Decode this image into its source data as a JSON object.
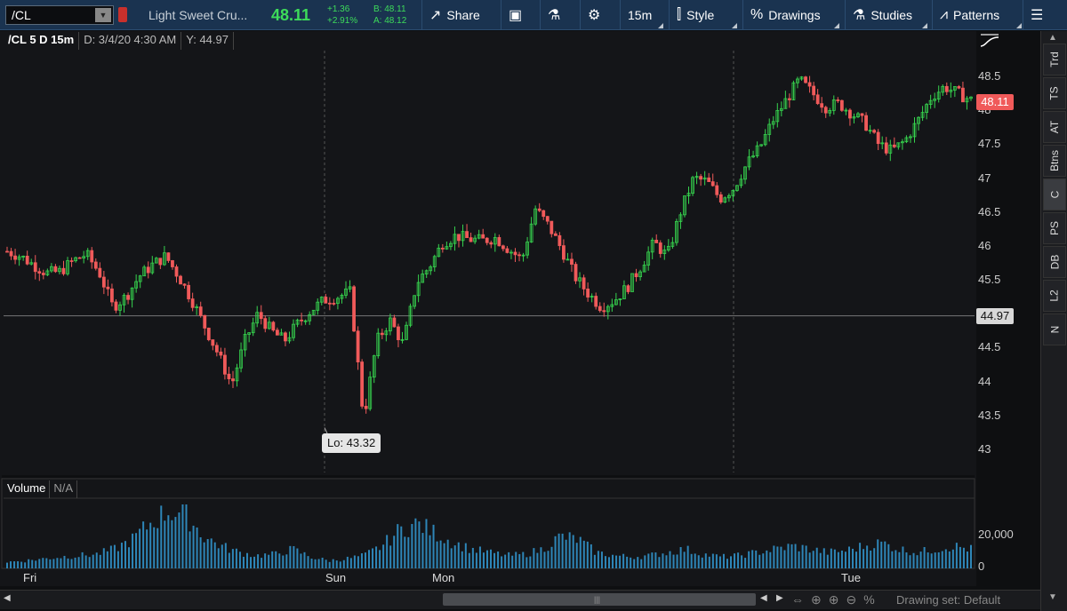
{
  "toolbar": {
    "symbol": "/CL",
    "description": "Light Sweet Cru...",
    "last_price": "48.11",
    "net_change": "+1.36",
    "pct_change": "+2.91%",
    "bid": "B: 48.11",
    "ask": "A: 48.12",
    "share_label": "Share",
    "timeframe_label": "15m",
    "style_label": "Style",
    "drawings_label": "Drawings",
    "studies_label": "Studies",
    "patterns_label": "Patterns",
    "accent_up": "#3ddc5a",
    "accent_down": "#f05a5a"
  },
  "chart_header": {
    "symbol_tf": "/CL 5 D 15m",
    "date": "D: 3/4/20 4:30 AM",
    "y": "Y: 44.97"
  },
  "price_axis": {
    "ticks": [
      "48.5",
      "48",
      "47.5",
      "47",
      "46.5",
      "46",
      "45.5",
      "45",
      "44.5",
      "44",
      "43.5",
      "43"
    ],
    "last_tag": "48.11",
    "crosshair_tag": "44.97"
  },
  "low_label": "Lo: 43.32",
  "volume": {
    "title": "Volume",
    "value": "N/A",
    "ticks": [
      "20,000",
      "0"
    ]
  },
  "time_axis": [
    "Fri",
    "Sun",
    "Mon",
    "Tue"
  ],
  "footer": {
    "drawing_set": "Drawing set: Default"
  },
  "side_tabs": [
    "Trd",
    "TS",
    "AT",
    "Btns",
    "C",
    "PS",
    "DB",
    "L2",
    "N"
  ],
  "chart_data": {
    "type": "candlestick",
    "price_range": [
      42.8,
      48.8
    ],
    "crosshair_price": 44.97,
    "low": 43.32,
    "close_path": [
      45.92,
      45.85,
      45.72,
      45.6,
      45.62,
      45.78,
      45.88,
      45.6,
      45.1,
      45.25,
      45.55,
      45.72,
      45.85,
      45.55,
      45.2,
      44.8,
      44.4,
      43.95,
      44.6,
      45.0,
      44.75,
      44.6,
      44.85,
      45.05,
      45.2,
      45.25,
      45.32,
      43.45,
      44.6,
      44.9,
      44.55,
      45.45,
      45.7,
      46.05,
      46.15,
      46.1,
      46.08,
      46.12,
      45.95,
      45.8,
      46.55,
      46.3,
      45.95,
      45.55,
      45.3,
      45.1,
      45.2,
      45.4,
      45.7,
      46.05,
      45.85,
      46.5,
      47.0,
      46.95,
      46.7,
      46.85,
      47.2,
      47.45,
      47.85,
      48.15,
      48.45,
      48.25,
      48.05,
      48.1,
      47.95,
      47.8,
      47.5,
      47.4,
      47.55,
      47.85,
      48.2,
      48.35,
      48.25,
      48.15
    ],
    "volume_relative": [
      0.1,
      0.12,
      0.15,
      0.18,
      0.2,
      0.22,
      0.3,
      0.45,
      0.7,
      0.9,
      0.85,
      0.5,
      0.35,
      0.25,
      0.2,
      0.22,
      0.3,
      0.18,
      0.12,
      0.15,
      0.2,
      0.35,
      0.6,
      0.7,
      0.55,
      0.4,
      0.3,
      0.25,
      0.2,
      0.22,
      0.3,
      0.5,
      0.45,
      0.25,
      0.2,
      0.18,
      0.2,
      0.25,
      0.3,
      0.22,
      0.18,
      0.2,
      0.25,
      0.3,
      0.35,
      0.3,
      0.25,
      0.28,
      0.35,
      0.4,
      0.3,
      0.25,
      0.3,
      0.35,
      0.3
    ]
  }
}
